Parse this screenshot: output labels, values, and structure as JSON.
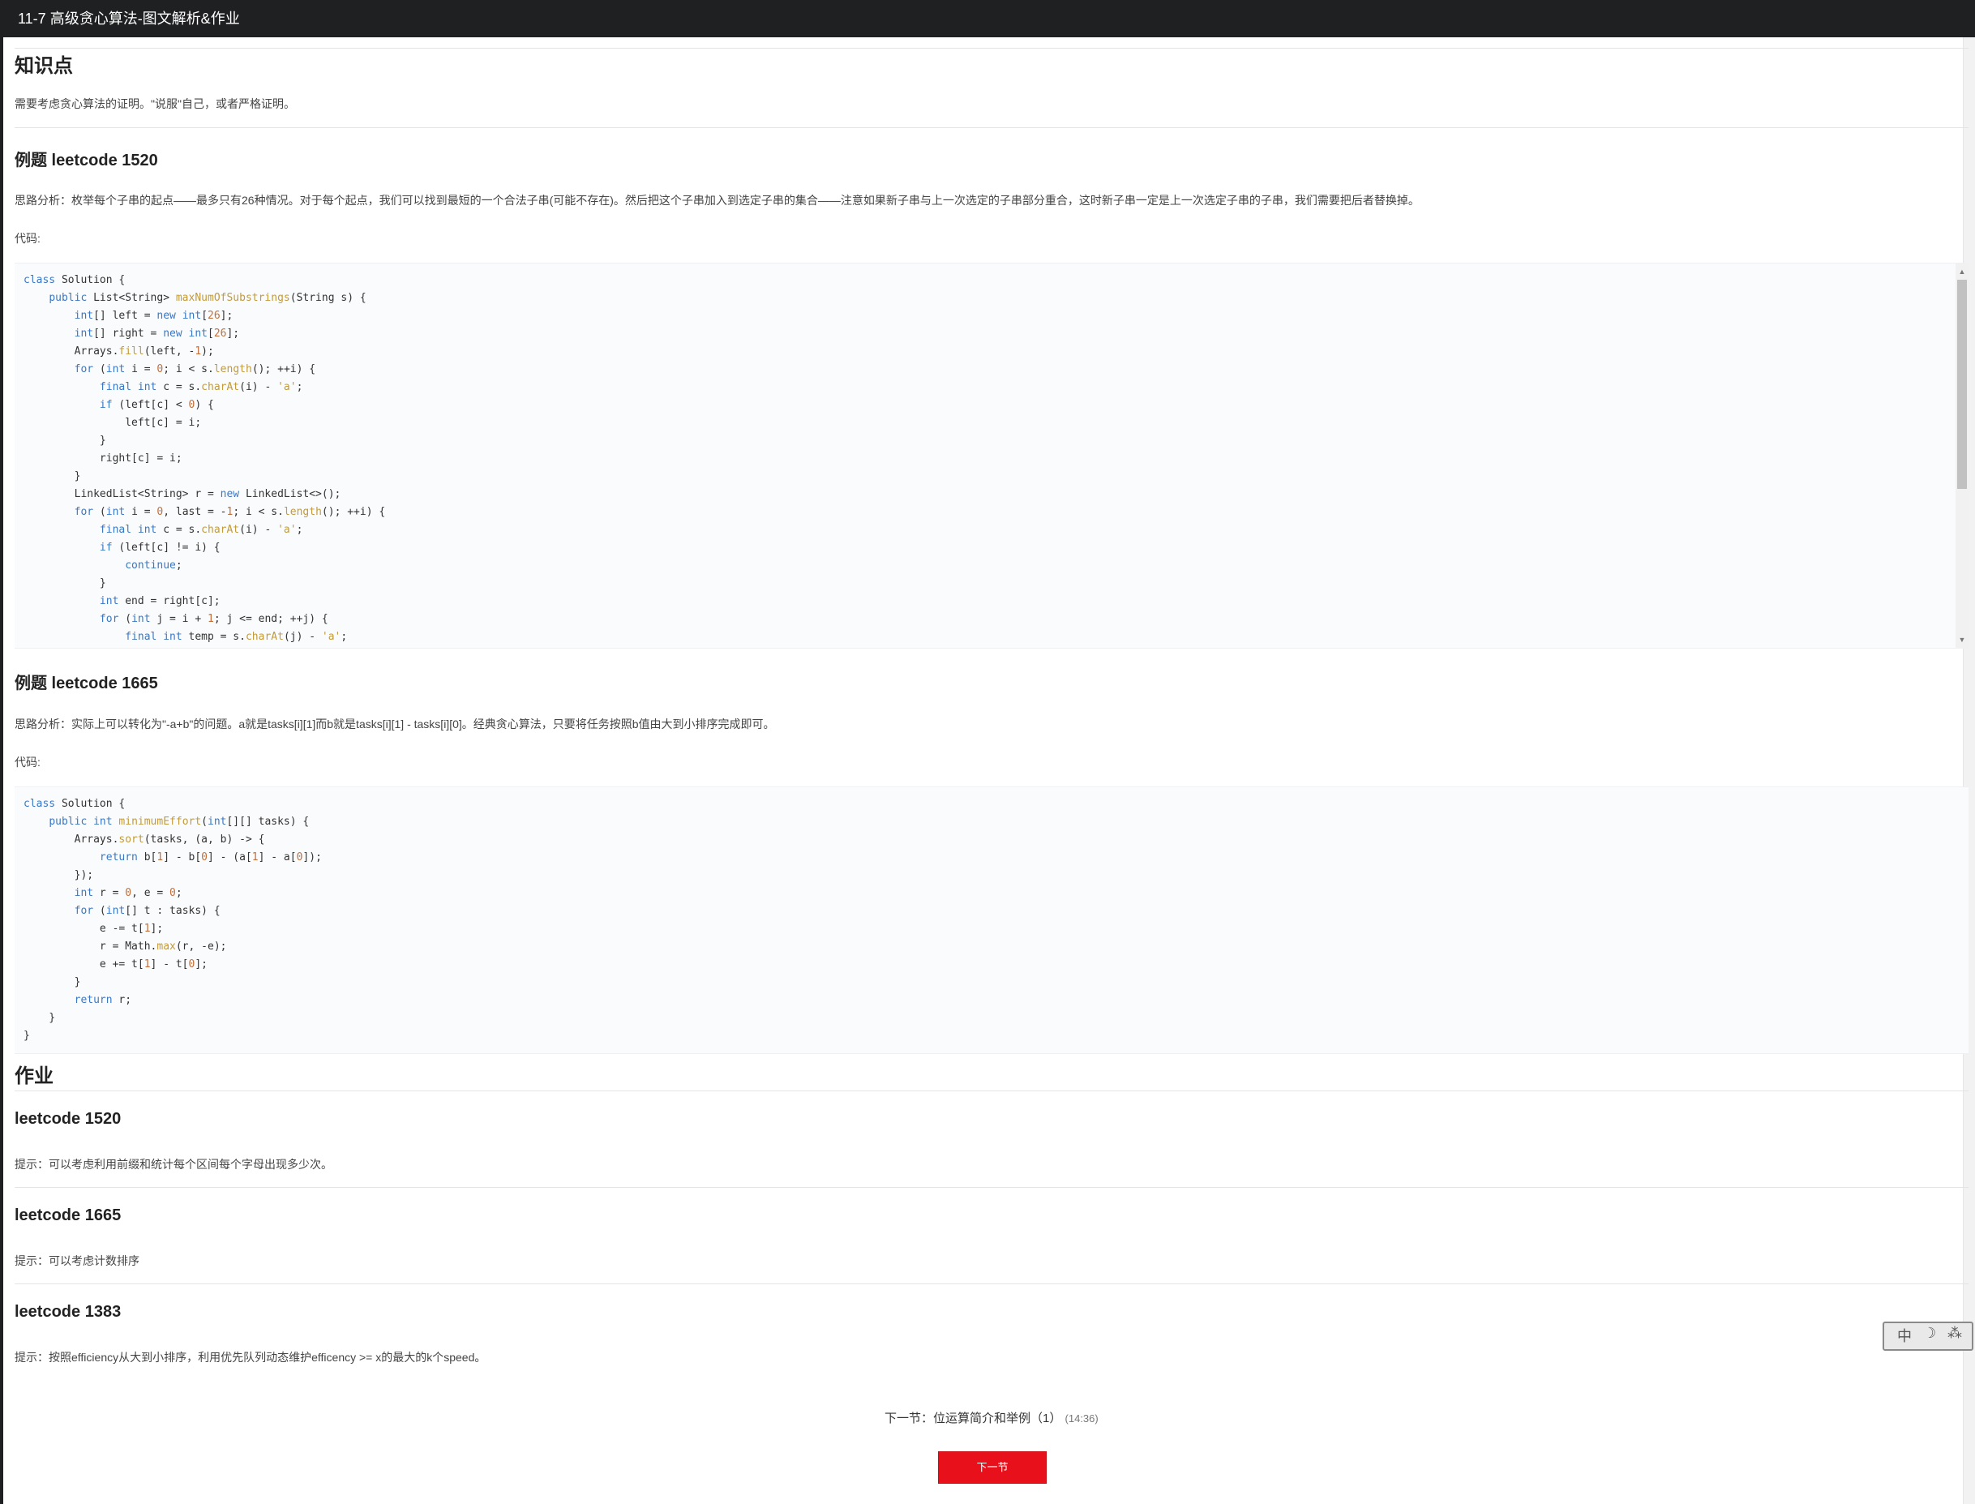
{
  "header": {
    "title": "11-7 高级贪心算法-图文解析&作业"
  },
  "knowledge": {
    "heading": "知识点",
    "text": "需要考虑贪心算法的证明。\"说服\"自己，或者严格证明。"
  },
  "example1": {
    "heading": "例题 leetcode 1520",
    "analysis": "思路分析：枚举每个子串的起点——最多只有26种情况。对于每个起点，我们可以找到最短的一个合法子串(可能不存在)。然后把这个子串加入到选定子串的集合——注意如果新子串与上一次选定的子串部分重合，这时新子串一定是上一次选定子串的子串，我们需要把后者替换掉。",
    "code_label": "代码:",
    "code": [
      "class Solution {",
      "    public List<String> maxNumOfSubstrings(String s) {",
      "        int[] left = new int[26];",
      "        int[] right = new int[26];",
      "        Arrays.fill(left, -1);",
      "        for (int i = 0; i < s.length(); ++i) {",
      "            final int c = s.charAt(i) - 'a';",
      "            if (left[c] < 0) {",
      "                left[c] = i;",
      "            }",
      "            right[c] = i;",
      "        }",
      "        LinkedList<String> r = new LinkedList<>();",
      "        for (int i = 0, last = -1; i < s.length(); ++i) {",
      "            final int c = s.charAt(i) - 'a';",
      "            if (left[c] != i) {",
      "                continue;",
      "            }",
      "            int end = right[c];",
      "            for (int j = i + 1; j <= end; ++j) {",
      "                final int temp = s.charAt(j) - 'a';"
    ]
  },
  "example2": {
    "heading": "例题 leetcode 1665",
    "analysis": "思路分析：实际上可以转化为\"-a+b\"的问题。a就是tasks[i][1]而b就是tasks[i][1] - tasks[i][0]。经典贪心算法，只要将任务按照b值由大到小排序完成即可。",
    "code_label": "代码:",
    "code": [
      "class Solution {",
      "    public int minimumEffort(int[][] tasks) {",
      "        Arrays.sort(tasks, (a, b) -> {",
      "            return b[1] - b[0] - (a[1] - a[0]);",
      "        });",
      "        int r = 0, e = 0;",
      "        for (int[] t : tasks) {",
      "            e -= t[1];",
      "            r = Math.max(r, -e);",
      "            e += t[1] - t[0];",
      "        }",
      "        return r;",
      "    }",
      "}"
    ]
  },
  "homework": {
    "heading": "作业",
    "items": [
      {
        "title": "leetcode 1520",
        "hint": "提示：可以考虑利用前缀和统计每个区间每个字母出现多少次。"
      },
      {
        "title": "leetcode 1665",
        "hint": "提示：可以考虑计数排序"
      },
      {
        "title": "leetcode 1383",
        "hint": "提示：按照efficiency从大到小排序，利用优先队列动态维护efficency >= x的最大的k个speed。"
      }
    ]
  },
  "next": {
    "info": "下一节：位运算简介和举例（1）",
    "duration": "(14:36)",
    "button": "下一节"
  },
  "ime": {
    "chars": [
      "中",
      "☽",
      "⁂"
    ]
  },
  "colors": {
    "topbar": "#1f2022",
    "button": "#e8111b",
    "keyword": "#3b78c2",
    "function": "#c29b3b"
  }
}
